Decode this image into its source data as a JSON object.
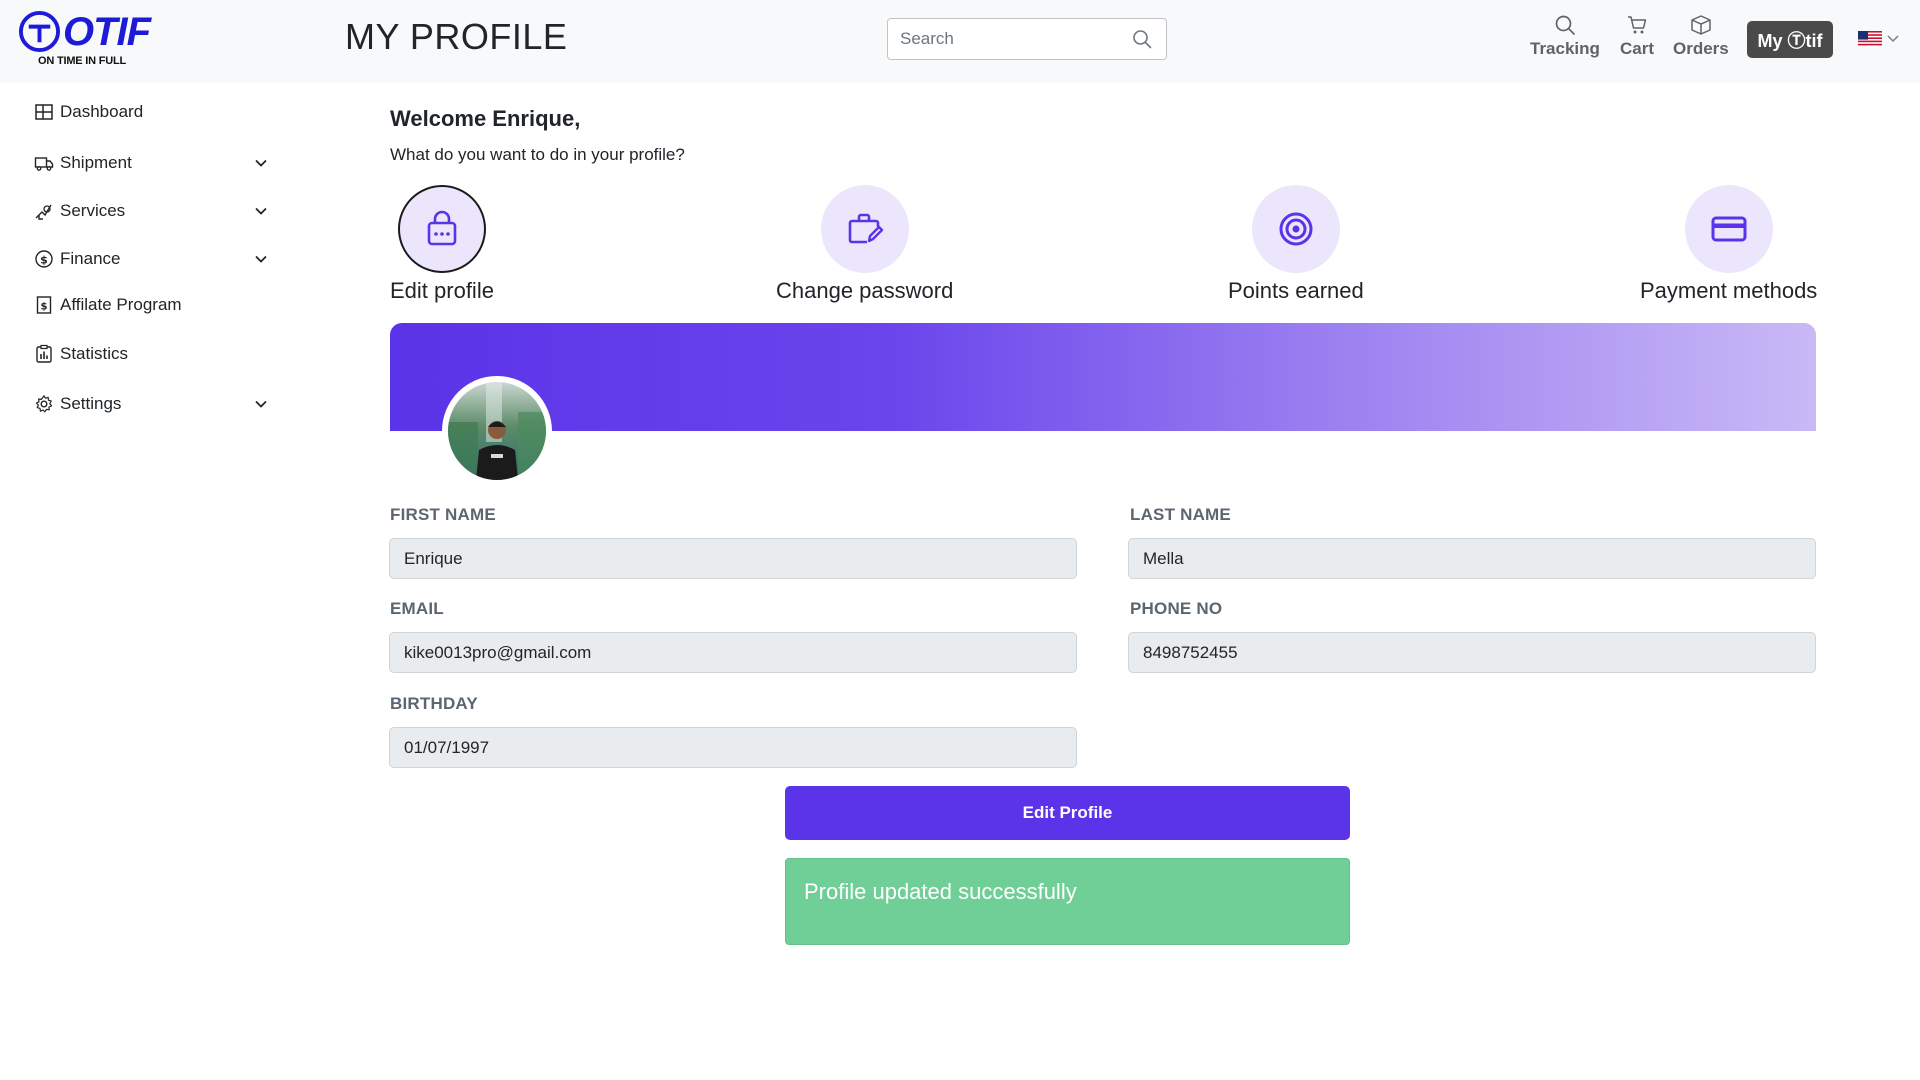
{
  "header": {
    "logo_word": "OTIF",
    "logo_tagline": "ON TIME IN FULL",
    "page_title": "MY PROFILE",
    "search_placeholder": "Search",
    "nav": {
      "tracking": "Tracking",
      "cart": "Cart",
      "orders": "Orders"
    },
    "my_otif_label": "My Ⓣtif",
    "language_flag": "us-flag-icon"
  },
  "sidebar": {
    "items": [
      {
        "label": "Dashboard",
        "icon": "dashboard-icon",
        "expandable": false
      },
      {
        "label": "Shipment",
        "icon": "truck-icon",
        "expandable": true
      },
      {
        "label": "Services",
        "icon": "services-icon",
        "expandable": true
      },
      {
        "label": "Finance",
        "icon": "dollar-icon",
        "expandable": true
      },
      {
        "label": "Affilate Program",
        "icon": "affiliate-icon",
        "expandable": false
      },
      {
        "label": "Statistics",
        "icon": "statistics-icon",
        "expandable": false
      },
      {
        "label": "Settings",
        "icon": "gear-icon",
        "expandable": true
      }
    ]
  },
  "main": {
    "welcome": "Welcome Enrique,",
    "subtitle": "What do you want to do in your profile?",
    "actions": [
      {
        "label": "Edit profile",
        "icon": "lock-bag-icon",
        "active": true
      },
      {
        "label": "Change password",
        "icon": "briefcase-pencil-icon",
        "active": false
      },
      {
        "label": "Points earned",
        "icon": "target-icon",
        "active": false
      },
      {
        "label": "Payment methods",
        "icon": "credit-card-icon",
        "active": false
      }
    ],
    "form": {
      "first_name_label": "FIRST NAME",
      "first_name": "Enrique",
      "last_name_label": "LAST NAME",
      "last_name": "Mella",
      "email_label": "EMAIL",
      "email": "kike0013pro@gmail.com",
      "phone_label": "PHONE NO",
      "phone": "8498752455",
      "birthday_label": "BIRTHDAY",
      "birthday": "01/07/1997"
    },
    "edit_button": "Edit Profile",
    "alert": "Profile updated successfully"
  },
  "colors": {
    "brand": "#1d1bd8",
    "accent": "#5b33e8",
    "icon_accent": "#5b33e8",
    "success": "#6fcf97"
  }
}
